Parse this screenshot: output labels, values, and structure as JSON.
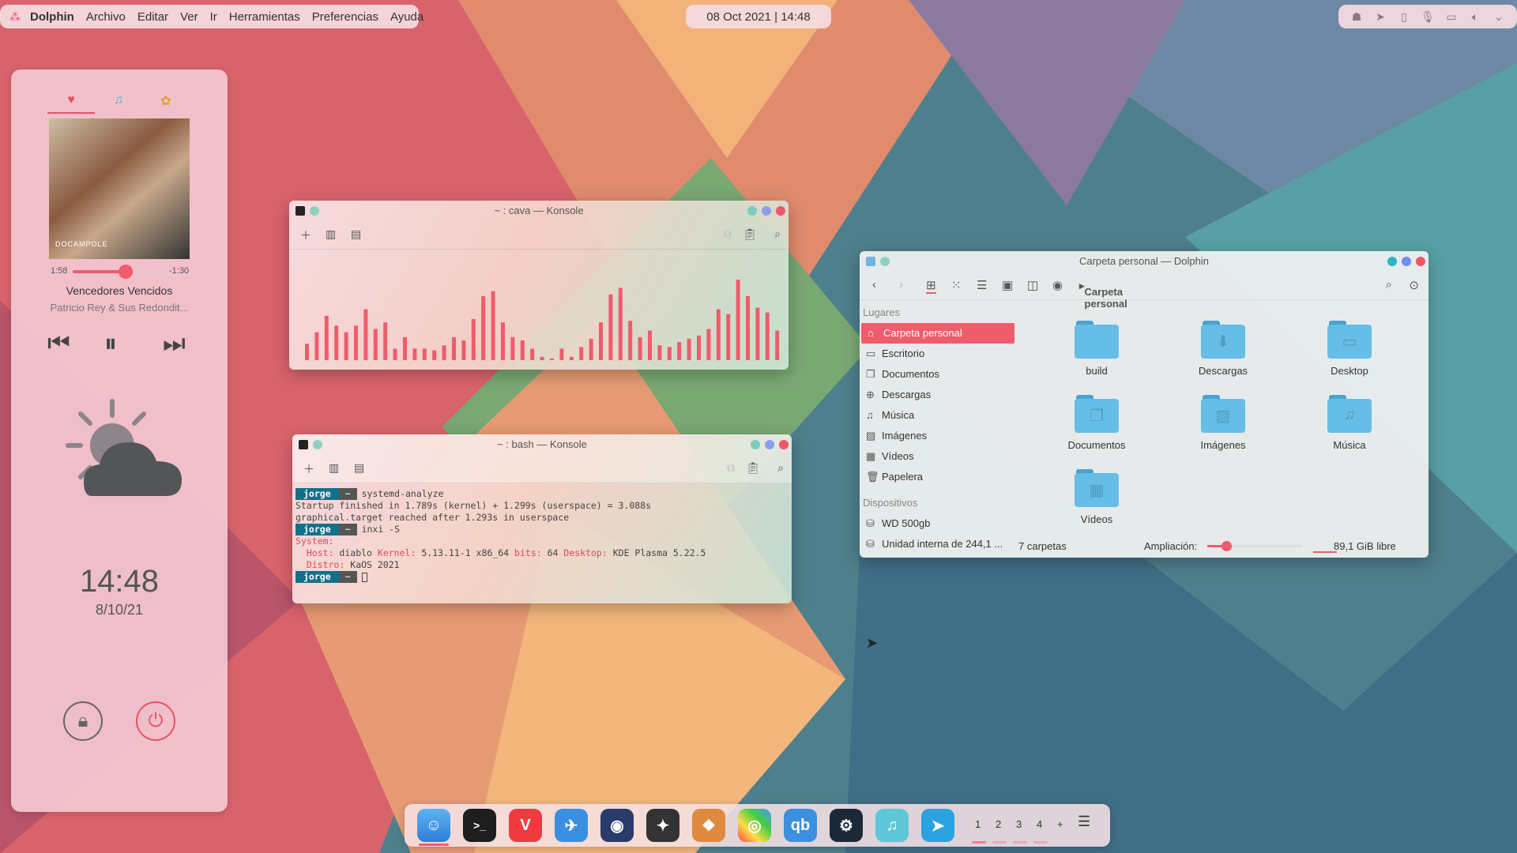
{
  "menubar": {
    "app": "Dolphin",
    "items": [
      "Archivo",
      "Editar",
      "Ver",
      "Ir",
      "Herramientas",
      "Preferencias",
      "Ayuda"
    ]
  },
  "clock": "08 Oct 2021 | 14:48",
  "tray": [
    "ghost-icon",
    "send-icon",
    "battery-icon",
    "mic-icon",
    "display-icon",
    "volume-icon",
    "chevron-down-icon"
  ],
  "player": {
    "elapsed": "1:58",
    "remaining": "-1:30",
    "progress": 0.57,
    "track": "Vencedores Vencidos",
    "artist": "Patricio Rey & Sus Redondit...",
    "album_text": "DOCAMPOLE"
  },
  "widget": {
    "time": "14:48",
    "date": "8/10/21"
  },
  "cava": {
    "title": "~ : cava — Konsole",
    "levels": [
      0.2,
      0.34,
      0.54,
      0.42,
      0.34,
      0.42,
      0.62,
      0.38,
      0.46,
      0.14,
      0.28,
      0.14,
      0.14,
      0.12,
      0.18,
      0.28,
      0.24,
      0.5,
      0.78,
      0.84,
      0.46,
      0.28,
      0.24,
      0.14,
      0.04,
      0.02,
      0.14,
      0.04,
      0.16,
      0.26,
      0.46,
      0.8,
      0.88,
      0.48,
      0.28,
      0.36,
      0.18,
      0.16,
      0.22,
      0.26,
      0.3,
      0.38,
      0.62,
      0.56,
      0.98,
      0.78,
      0.64,
      0.58,
      0.36
    ]
  },
  "bash": {
    "title": "~ : bash — Konsole",
    "user": "jorge",
    "pwd": "~",
    "cmd1": "systemd-analyze",
    "out1": "Startup finished in 1.789s (kernel) + 1.299s (userspace) = 3.088s",
    "out2": "graphical.target reached after 1.293s in userspace",
    "cmd2": "inxi -S",
    "sys": "System:",
    "host_k": "Host:",
    "host_v": "diablo",
    "kernel_k": "Kernel:",
    "kernel_v": "5.13.11-1 x86_64",
    "bits_k": "bits:",
    "bits_v": "64",
    "desk_k": "Desktop:",
    "desk_v": "KDE Plasma 5.22.5",
    "distro_k": "Distro:",
    "distro_v": "KaOS 2021"
  },
  "dolphin": {
    "title": "Carpeta personal — Dolphin",
    "breadcrumb": "Carpeta personal",
    "places_header": "Lugares",
    "places": [
      "Carpeta personal",
      "Escritorio",
      "Documentos",
      "Descargas",
      "Música",
      "Imágenes",
      "Vídeos",
      "Papelera"
    ],
    "devices_header": "Dispositivos",
    "devices": [
      "WD 500gb",
      "Unidad interna de 244,1 ..."
    ],
    "folders": [
      "build",
      "Descargas",
      "Desktop",
      "Documentos",
      "Imágenes",
      "Música",
      "Vídeos"
    ],
    "status_count": "7 carpetas",
    "zoom_label": "Ampliación:",
    "free": "89,1 GiB libre",
    "zoom": 0.2
  },
  "workspaces": [
    "1",
    "2",
    "3",
    "4",
    "+"
  ],
  "colors": {
    "accent": "#ef5c6c",
    "folder": "#66bde5",
    "prompt": "#13708a"
  }
}
